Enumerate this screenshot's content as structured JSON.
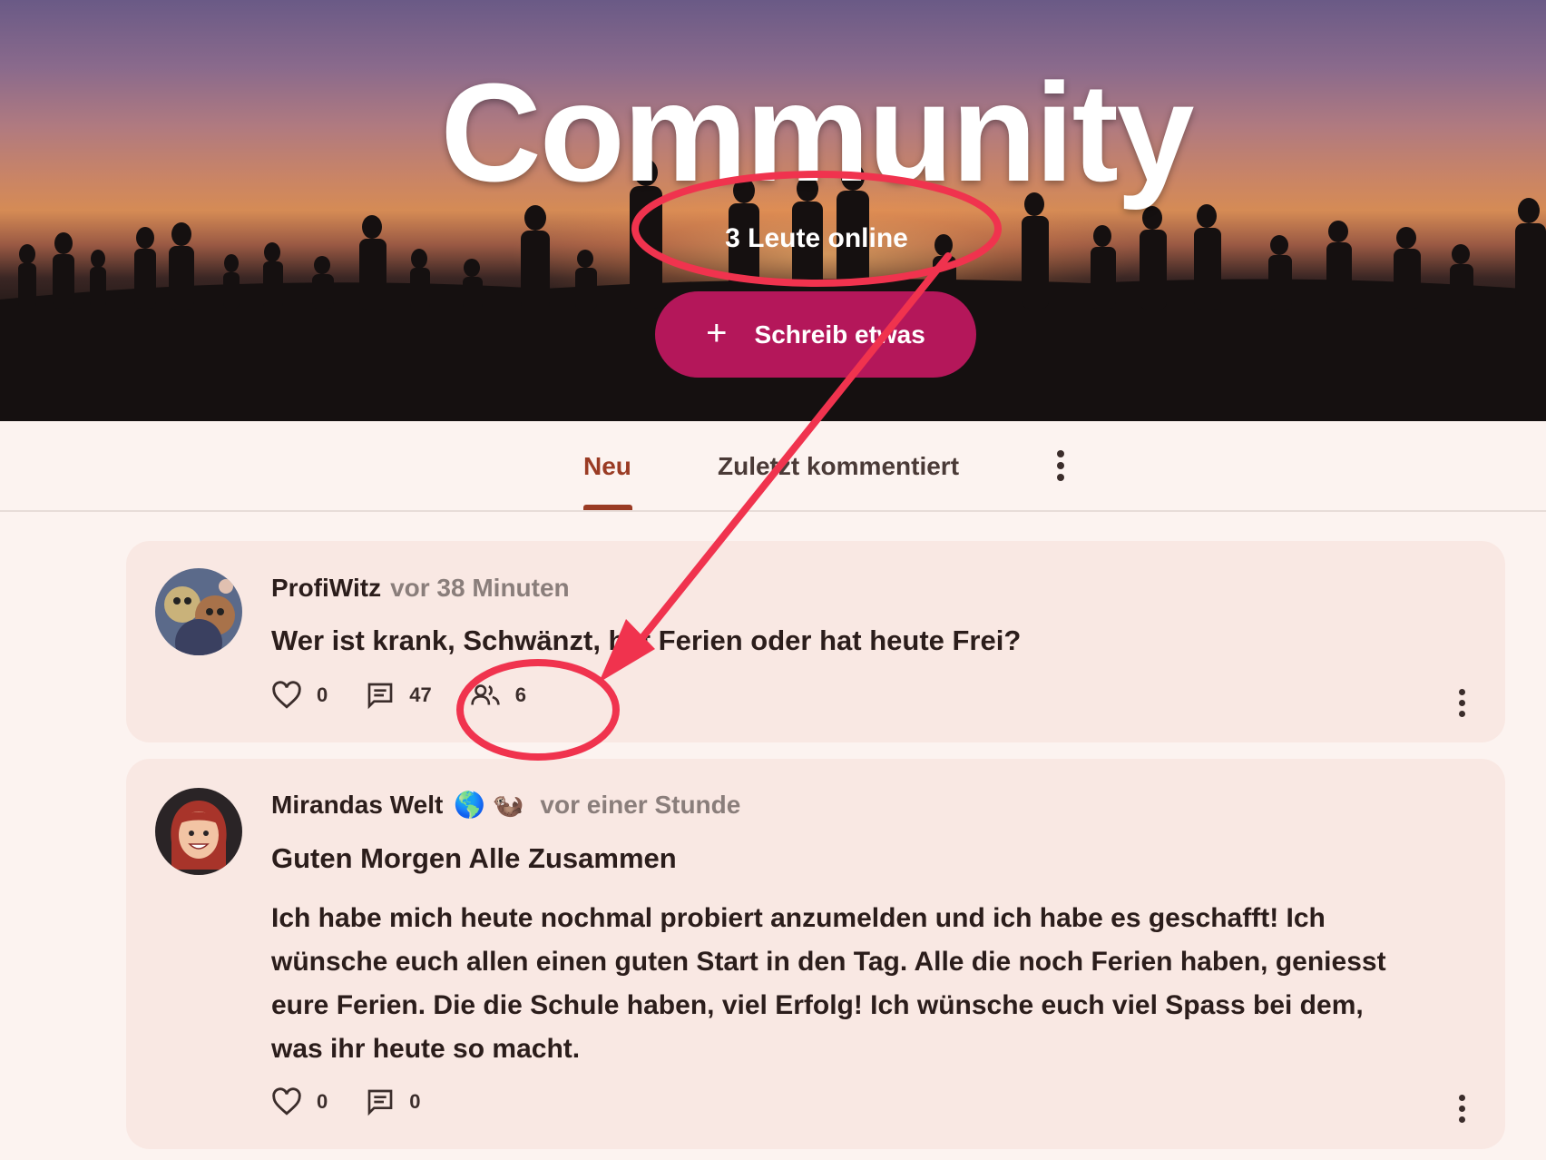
{
  "hero": {
    "title": "Community",
    "online_text": "3 Leute online",
    "write_button": {
      "icon": "plus-icon",
      "label": "Schreib etwas"
    }
  },
  "tabs": {
    "items": [
      {
        "label": "Neu",
        "active": true
      },
      {
        "label": "Zuletzt kommentiert",
        "active": false
      }
    ],
    "more_icon": "more-vertical-icon"
  },
  "posts": [
    {
      "author": "ProfiWitz",
      "time": "vor 38 Minuten",
      "title": "Wer ist krank, Schwänzt, hat Ferien oder hat heute Frei?",
      "likes": "0",
      "comments": "47",
      "participants": "6"
    },
    {
      "author": "Mirandas Welt",
      "author_emojis": "🌎 🦦",
      "time": "vor einer Stunde",
      "title": "Guten Morgen Alle Zusammen",
      "body": "Ich habe mich heute nochmal probiert anzumelden und ich habe es geschafft! Ich wünsche euch allen einen guten Start in den Tag. Alle die noch Ferien haben, geniesst eure Ferien. Die die Schule haben, viel Erfolg! Ich wünsche euch viel Spass bei dem, was ihr heute so macht.",
      "likes": "0",
      "comments": "0"
    }
  ],
  "colors": {
    "accent_button": "#b4175a",
    "active_tab": "#9a3b24",
    "card_bg": "#f9e8e3",
    "page_bg": "#fcf3f0",
    "annotation": "#f0334e"
  }
}
